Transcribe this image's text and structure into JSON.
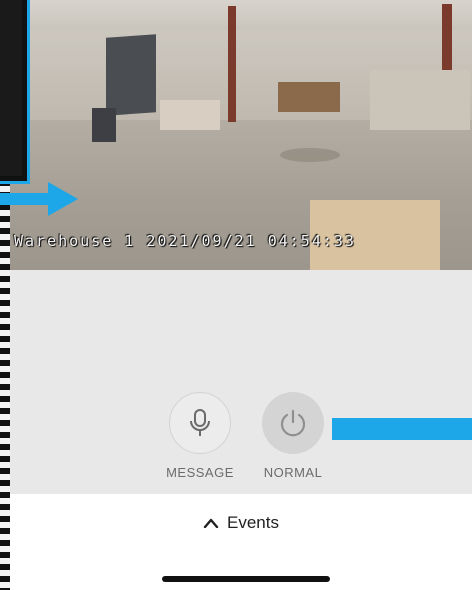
{
  "camera": {
    "overlay_text": "Warehouse 1 2021/09/21 04:54:33"
  },
  "controls": {
    "message_label": "MESSAGE",
    "normal_label": "NORMAL",
    "message_icon": "microphone-icon",
    "normal_icon": "power-icon"
  },
  "events": {
    "label": "Events",
    "icon": "chevron-up-icon"
  },
  "colors": {
    "accent": "#1ea7e8",
    "feed_text": "#f4f4f4",
    "control_bg": "#e8e8e8"
  }
}
